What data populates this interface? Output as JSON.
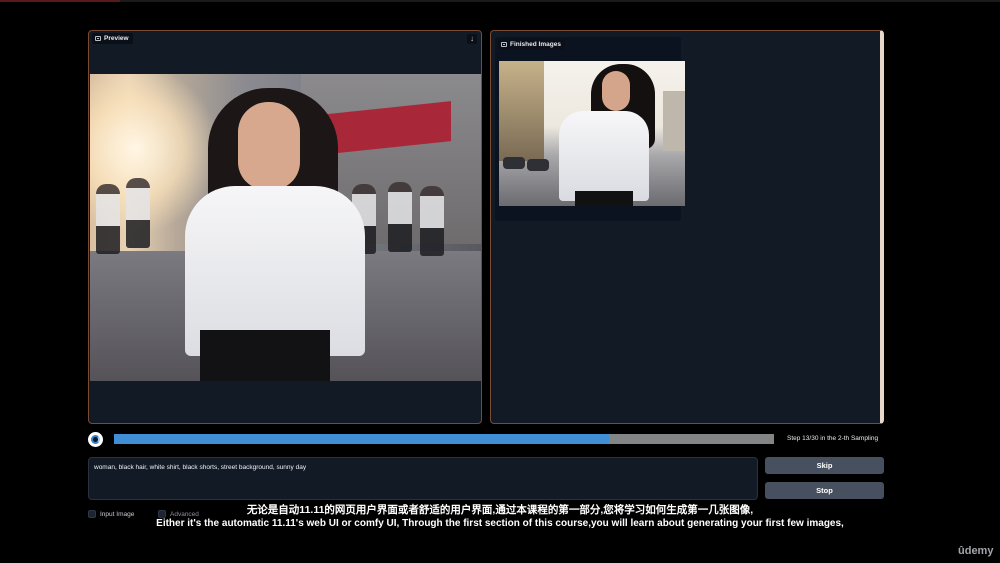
{
  "preview": {
    "label": "Preview",
    "download_icon": "download-icon"
  },
  "finished": {
    "label": "Finished Images"
  },
  "progress": {
    "fraction": 0.75,
    "status_text": "Step 13/30 in the 2-th Sampling"
  },
  "prompt": {
    "value": "woman, black hair, white shirt, black shorts, street background, sunny day"
  },
  "buttons": {
    "skip": "Skip",
    "stop": "Stop"
  },
  "options": {
    "input_image": "Input Image",
    "advanced": "Advanced"
  },
  "subtitles": {
    "zh": "无论是自动11.11的网页用户界面或者舒适的用户界面,通过本课程的第一部分,您将学习如何生成第一几张图像,",
    "en": "Either it's the automatic 11.11's web UI or comfy UI, Through the first section of this course,you will learn about generating your first few images,"
  },
  "brand": {
    "logo_text": "ûdemy"
  },
  "colors": {
    "panel_bg": "#121a26",
    "panel_border": "#7a4a34",
    "progress_fill": "#3f8ed6",
    "progress_track": "#838486",
    "button_bg": "#46505e"
  }
}
